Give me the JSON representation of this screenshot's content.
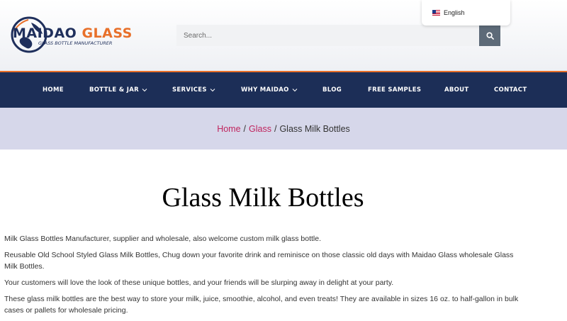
{
  "brand": {
    "name_part1": "MAIDAO",
    "name_part2": "GLASS",
    "tagline": "GLASS BOTTLE MANUFACTURER",
    "colors": {
      "navy": "#1c2e57",
      "orange": "#e8702a",
      "link": "#c0245e"
    }
  },
  "search": {
    "placeholder": "Search...",
    "button_icon": "search-icon"
  },
  "language": {
    "label": "English",
    "flag_icon": "us-flag-icon"
  },
  "nav": {
    "items": [
      {
        "label": "HOME",
        "has_dropdown": false
      },
      {
        "label": "BOTTLE & JAR",
        "has_dropdown": true
      },
      {
        "label": "SERVICES",
        "has_dropdown": true
      },
      {
        "label": "WHY MAIDAO",
        "has_dropdown": true
      },
      {
        "label": "BLOG",
        "has_dropdown": false
      },
      {
        "label": "FREE SAMPLES",
        "has_dropdown": false
      },
      {
        "label": "ABOUT",
        "has_dropdown": false
      },
      {
        "label": "CONTACT",
        "has_dropdown": false
      }
    ]
  },
  "breadcrumb": {
    "home": "Home",
    "sep": "/",
    "category": "Glass",
    "current": "Glass Milk Bottles"
  },
  "page": {
    "title": "Glass Milk Bottles",
    "paragraphs": [
      "Milk Glass Bottles Manufacturer, supplier and wholesale, also welcome custom milk glass bottle.",
      "Reusable Old School Styled Glass Milk Bottles, Chug down your favorite drink and reminisce on those classic old days with Maidao Glass wholesale Glass Milk Bottles.",
      "Your customers will love the look of these unique bottles, and your friends will be slurping away in delight at your party.",
      "These glass milk bottles are the best way to store your milk, juice, smoothie, alcohol, and even treats! They are available in sizes 16 oz. to half-gallon in bulk cases or pallets for wholesale pricing."
    ]
  }
}
